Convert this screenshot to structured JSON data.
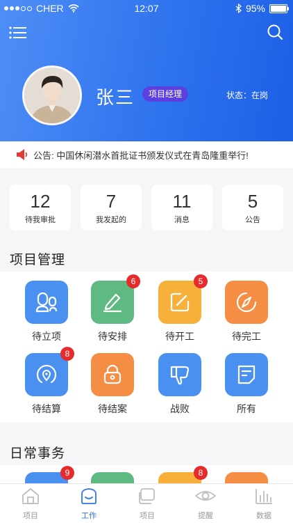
{
  "status_bar": {
    "carrier": "CHER",
    "time": "12:07",
    "battery": "95%"
  },
  "profile": {
    "name": "张三",
    "role": "项目经理",
    "status": "状态：在岗"
  },
  "notice": {
    "text": "公告: 中国休闲潜水首批证书颁发仪式在青岛隆重举行!"
  },
  "stats": [
    {
      "value": "12",
      "label": "待我审批"
    },
    {
      "value": "7",
      "label": "我发起的"
    },
    {
      "value": "11",
      "label": "消息"
    },
    {
      "value": "5",
      "label": "公告"
    }
  ],
  "project_section": {
    "title": "项目管理",
    "tiles": [
      {
        "label": "待立项",
        "icon": "people-icon",
        "color": "#4a90f0",
        "badge": ""
      },
      {
        "label": "待安排",
        "icon": "pen-icon",
        "color": "#5fb982",
        "badge": "6"
      },
      {
        "label": "待开工",
        "icon": "edit-icon",
        "color": "#f7b13a",
        "badge": "5"
      },
      {
        "label": "待完工",
        "icon": "compass-icon",
        "color": "#f58d45",
        "badge": ""
      },
      {
        "label": "待结算",
        "icon": "location-icon",
        "color": "#4a90f0",
        "badge": "8"
      },
      {
        "label": "待结案",
        "icon": "lock-icon",
        "color": "#f58d45",
        "badge": ""
      },
      {
        "label": "战败",
        "icon": "thumb-down-icon",
        "color": "#4a90f0",
        "badge": ""
      },
      {
        "label": "所有",
        "icon": "document-icon",
        "color": "#4a90f0",
        "badge": ""
      }
    ]
  },
  "daily_section": {
    "title": "日常事务",
    "tiles": [
      {
        "color": "#4a90f0",
        "badge": "9"
      },
      {
        "color": "#5fb982",
        "badge": ""
      },
      {
        "color": "#f7b13a",
        "badge": "8"
      },
      {
        "color": "#f58d45",
        "badge": ""
      }
    ]
  },
  "tabbar": [
    {
      "label": "项目",
      "icon": "home-icon",
      "active": false
    },
    {
      "label": "工作",
      "icon": "work-icon",
      "active": true
    },
    {
      "label": "项目",
      "icon": "stack-icon",
      "active": false
    },
    {
      "label": "提醒",
      "icon": "eye-icon",
      "active": false
    },
    {
      "label": "数据",
      "icon": "bar-chart-icon",
      "active": false
    }
  ]
}
